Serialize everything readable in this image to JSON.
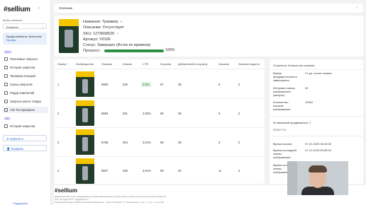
{
  "sidebar": {
    "logo": "#sellium",
    "collapse": "‹",
    "cabinet_label": "Выбор кабинета",
    "cabinet_value": "TrendLine",
    "tariff_title": "Тариф кабинета: Агентство",
    "tariff_sub": "Тарифы",
    "section1": "SEO",
    "items": [
      {
        "label": "Поисковые запросы",
        "icon": "search-list-icon"
      },
      {
        "label": "История запросов",
        "icon": "history-icon"
      },
      {
        "label": "Проверка позиций",
        "icon": "check-position-icon"
      },
      {
        "label": "Сканы запросов",
        "icon": "scan-icon"
      },
      {
        "label": "Радар изменений",
        "icon": "radar-icon"
      },
      {
        "label": "Запросы моего товара",
        "icon": "my-product-icon"
      },
      {
        "label": "A/Б Тестирование",
        "icon": "ab-test-icon"
      }
    ],
    "section2": "WB",
    "items2": [
      {
        "label": "История запросов",
        "icon": "history-icon"
      }
    ],
    "cabinets_btn": "Кабинеты",
    "profile_btn": "Профиль"
  },
  "description_bar": {
    "label": "Описание",
    "chevron": "›"
  },
  "product": {
    "name": "Название: Триммер",
    "description": "Описание: Отсутствует",
    "sku": "SKU: 12736685​29",
    "article": "Артикул: V0106",
    "status": "Статус: Завершен (Истек по времени)",
    "progress_label": "Прогресс:",
    "progress_value": "100%",
    "progress_fraction": 1.0
  },
  "table": {
    "headers": [
      "Номер",
      "Изображение",
      "Показов",
      "Кликов",
      "CTR",
      "Корзина",
      "Добавлений в корзину",
      "Заказов",
      "Заказов модели"
    ],
    "rows": [
      {
        "num": "1",
        "shows": "8900",
        "clicks": "320",
        "ctr": "3.6%",
        "cart": "97",
        "added": "39",
        "orders": "9",
        "model_orders": "2"
      },
      {
        "num": "2",
        "shows": "8594",
        "clicks": "251",
        "ctr": "2.92%",
        "cart": "96",
        "added": "35",
        "orders": "6",
        "model_orders": "2"
      },
      {
        "num": "3",
        "shows": "8768",
        "clicks": "264",
        "ctr": "3.01%",
        "cart": "86",
        "added": "29",
        "orders": "3",
        "model_orders": "2"
      },
      {
        "num": "4",
        "shows": "8827",
        "clicks": "266",
        "ctr": "3.01%",
        "cart": "96",
        "added": "40",
        "orders": "11",
        "model_orders": "2"
      }
    ]
  },
  "stats": {
    "strategy": "Стратегия: Количество показов",
    "rows": [
      {
        "label": "Время предварительного завершения",
        "value": "27 дн. после начала"
      },
      {
        "label": "Интервал смены изображения (минуты)",
        "value": "30"
      },
      {
        "label": "Количество показов изображения",
        "value": "10000"
      }
    ],
    "campaign_label": "ID кампаний продвижения",
    "campaign_value": "28992778",
    "time_start_label": "Время начала",
    "time_start_value": "07-01-2025 06:00:00",
    "time_last_label": "Время последней смены изображения",
    "time_last_value": "07-11-2025 05:00:00",
    "partial_label": "Время остановки смены изображения",
    "partial_value": "01-2025 05:00:00"
  },
  "footer": {
    "logo": "#sellium",
    "line1": "Данный веб-сайт носит информационно-справочный характер и ни при каких условиях не является публичной офертой",
    "line2": "ООО \"Антида ГРУП\", info@sellium.ru",
    "line3": "Юридический адрес: 196240, Российская Федерация, г. Санкт-Петербург, пл. Бухарестская, д. 12, к. 1, стр. 1, пом. 219",
    "support": "Поддержка"
  },
  "colors": {
    "accent": "#3b6fd8",
    "progress": "#2f8f43",
    "badge_bg": "#dff2e1"
  }
}
